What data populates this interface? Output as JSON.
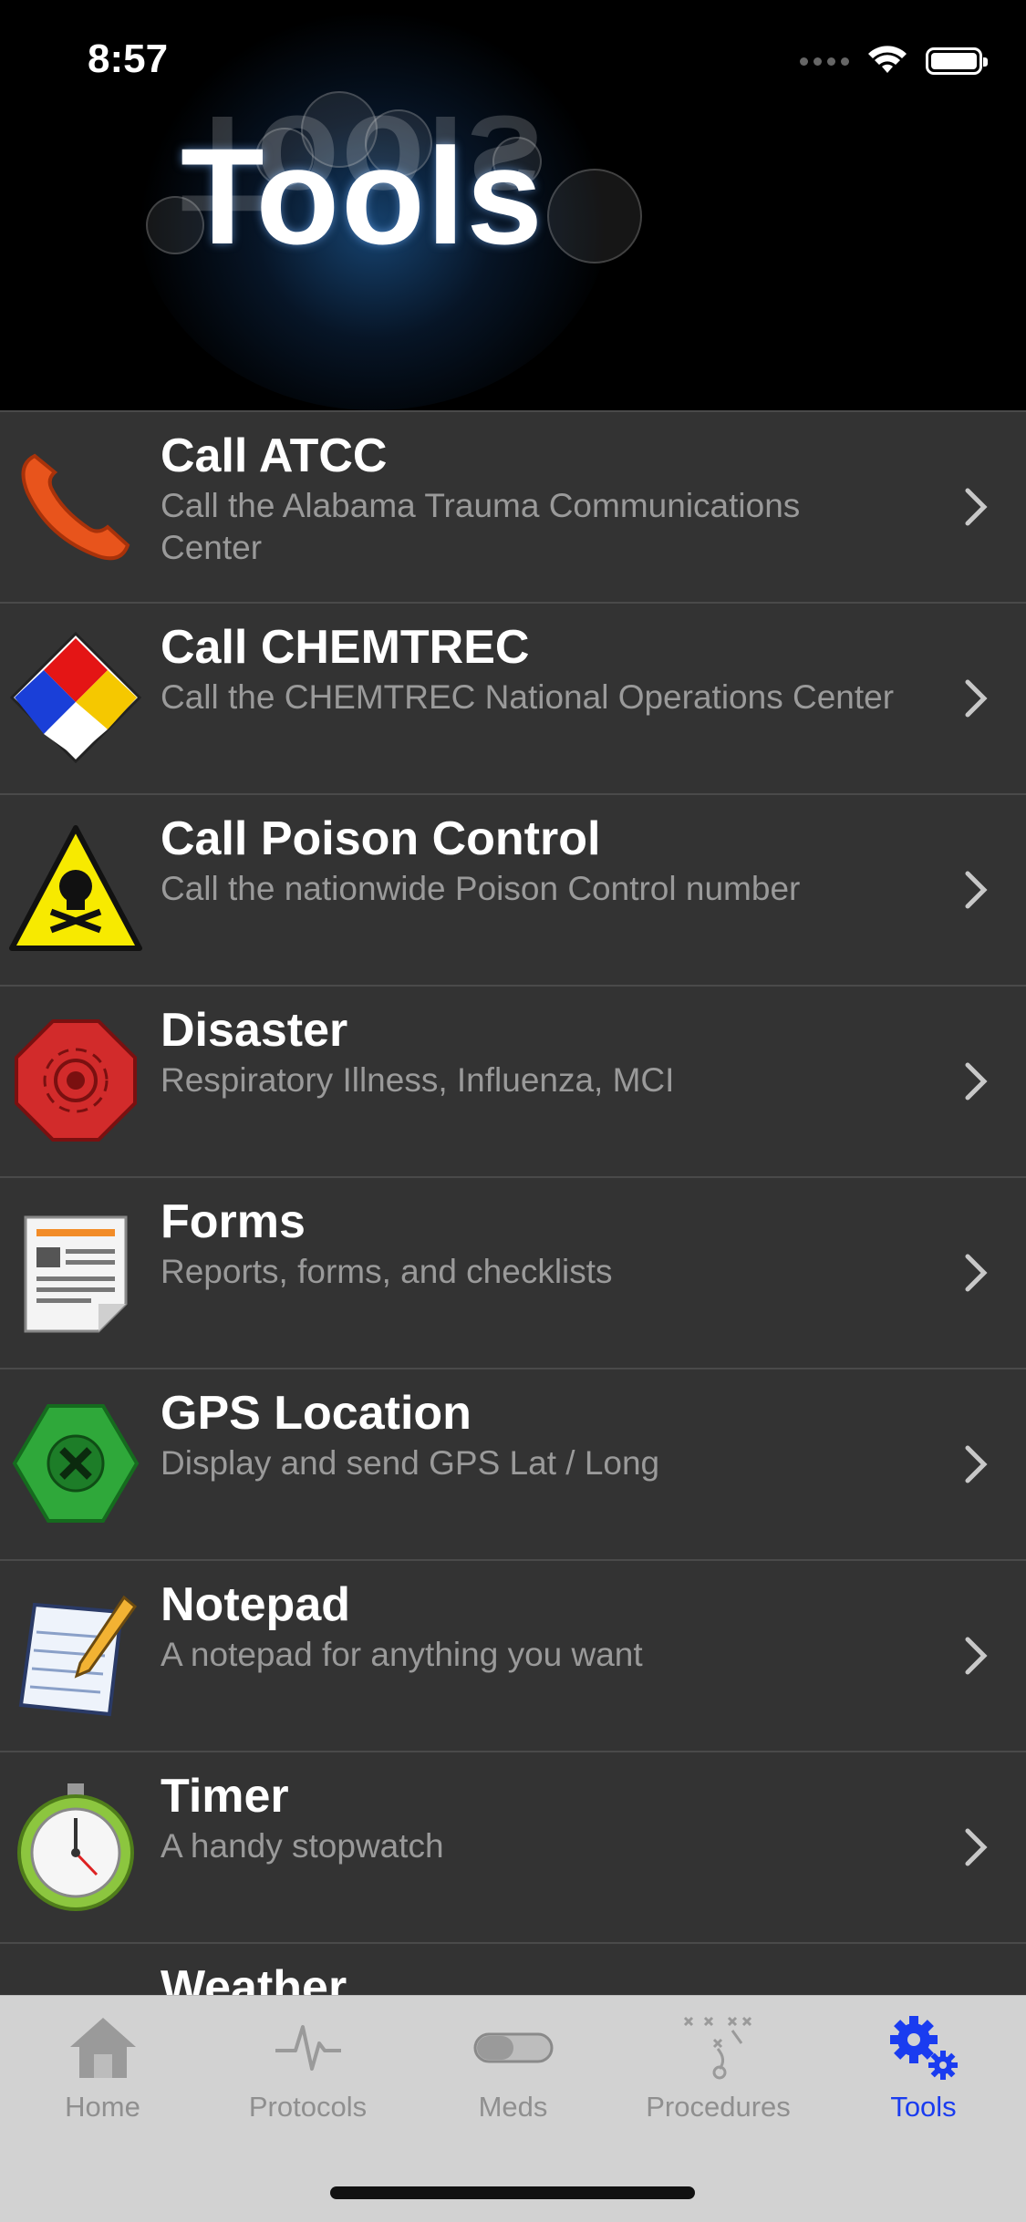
{
  "status_bar": {
    "time": "8:57"
  },
  "header": {
    "title": "Tools"
  },
  "list": [
    {
      "name": "Call ATCC",
      "desc": "Call the Alabama Trauma Communications Center",
      "icon": "phone-icon"
    },
    {
      "name": "Call CHEMTREC",
      "desc": "Call the CHEMTREC National Operations Center",
      "icon": "hazmat-diamond-icon"
    },
    {
      "name": "Call Poison Control",
      "desc": "Call the nationwide Poison Control number",
      "icon": "poison-warning-icon"
    },
    {
      "name": "Disaster",
      "desc": "Respiratory Illness, Influenza, MCI",
      "icon": "disaster-siren-icon"
    },
    {
      "name": "Forms",
      "desc": "Reports, forms, and checklists",
      "icon": "document-icon"
    },
    {
      "name": "GPS Location",
      "desc": "Display and send GPS Lat / Long",
      "icon": "gps-target-icon"
    },
    {
      "name": "Notepad",
      "desc": "A notepad for anything you want",
      "icon": "notepad-pencil-icon"
    },
    {
      "name": "Timer",
      "desc": "A handy stopwatch",
      "icon": "stopwatch-icon"
    },
    {
      "name": "Weather",
      "desc": "",
      "icon": "weather-sun-icon"
    }
  ],
  "tabbar": {
    "home": "Home",
    "protocols": "Protocols",
    "meds": "Meds",
    "procedures": "Procedures",
    "tools": "Tools",
    "active_color": "#1a3cf0",
    "inactive_color": "#8f8f8f"
  }
}
